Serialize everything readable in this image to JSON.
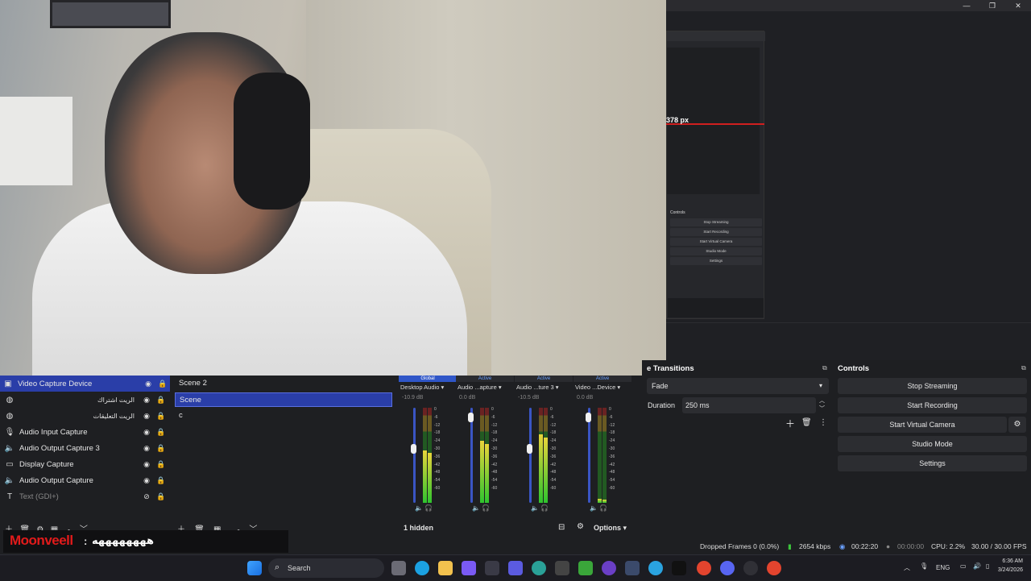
{
  "window_controls": {
    "minimize": "—",
    "maximize": "❐",
    "close": "✕"
  },
  "preview": {
    "measure_label": "378 px"
  },
  "mini_window": {
    "controls_title": "Controls",
    "buttons": [
      "Stop Streaming",
      "Start Recording",
      "Start Virtual Camera",
      "Studio Mode",
      "Settings"
    ]
  },
  "sources": {
    "items": [
      {
        "label": "Video Capture Device",
        "icon": "camera-icon",
        "selected": true,
        "dim": false,
        "rtl": false
      },
      {
        "label": "الريت اشتراك",
        "icon": "globe-icon",
        "selected": false,
        "dim": false,
        "rtl": true
      },
      {
        "label": "الريت التعليقات",
        "icon": "globe-icon",
        "selected": false,
        "dim": false,
        "rtl": true
      },
      {
        "label": "Audio Input Capture",
        "icon": "mic-icon",
        "selected": false,
        "dim": false,
        "rtl": false
      },
      {
        "label": "Audio Output Capture 3",
        "icon": "speaker-icon",
        "selected": false,
        "dim": false,
        "rtl": false
      },
      {
        "label": "Display Capture",
        "icon": "monitor-icon",
        "selected": false,
        "dim": false,
        "rtl": false
      },
      {
        "label": "Audio Output Capture",
        "icon": "speaker-icon",
        "selected": false,
        "dim": false,
        "rtl": false
      },
      {
        "label": "Text (GDI+)",
        "icon": "text-icon",
        "selected": false,
        "dim": true,
        "rtl": false
      }
    ]
  },
  "scenes": {
    "items": [
      "Scene 2",
      "Scene",
      "c"
    ],
    "selected_index": 1
  },
  "mixer": {
    "channels": [
      {
        "status": "Global",
        "name": "Desktop Audio",
        "db": "-10.9 dB",
        "level": 0.55,
        "fader": 0.62
      },
      {
        "status": "Active",
        "name": "Audio ...apture",
        "db": "0.0 dB",
        "level": 0.65,
        "fader": 0.95
      },
      {
        "status": "Active",
        "name": "Audio ...ture 3",
        "db": "-10.5 dB",
        "level": 0.72,
        "fader": 0.62
      },
      {
        "status": "Active",
        "name": "Video ...Device",
        "db": "0.0 dB",
        "level": 0.04,
        "fader": 0.95
      }
    ],
    "scale": [
      "0",
      "-6",
      "-12",
      "-18",
      "-24",
      "-30",
      "-36",
      "-42",
      "-48",
      "-54",
      "-60"
    ],
    "hidden_label": "1 hidden",
    "options_label": "Options"
  },
  "transitions": {
    "title": "e Transitions",
    "type": "Fade",
    "duration_label": "Duration",
    "duration_value": "250 ms"
  },
  "controls": {
    "title": "Controls",
    "buttons": [
      "Stop Streaming",
      "Start Recording",
      "Start Virtual Camera",
      "Studio Mode",
      "Settings"
    ]
  },
  "status": {
    "dropped": "Dropped Frames 0 (0.0%)",
    "bitrate": "2654 kbps",
    "stream_time": "00:22:20",
    "rec_time": "00:00:00",
    "cpu": "CPU: 2.2%",
    "fps": "30.00 / 30.00 FPS"
  },
  "chat": {
    "user": "Moonveell",
    "separator": ":",
    "message": "ههههههههه"
  },
  "taskbar": {
    "search": "Search",
    "lang": "ENG",
    "time": "6:36 AM",
    "date": "3/24/2026"
  },
  "colors": {
    "accent": "#2a3ea8",
    "red": "#d01f1f",
    "chat_name": "#e21b1b"
  }
}
